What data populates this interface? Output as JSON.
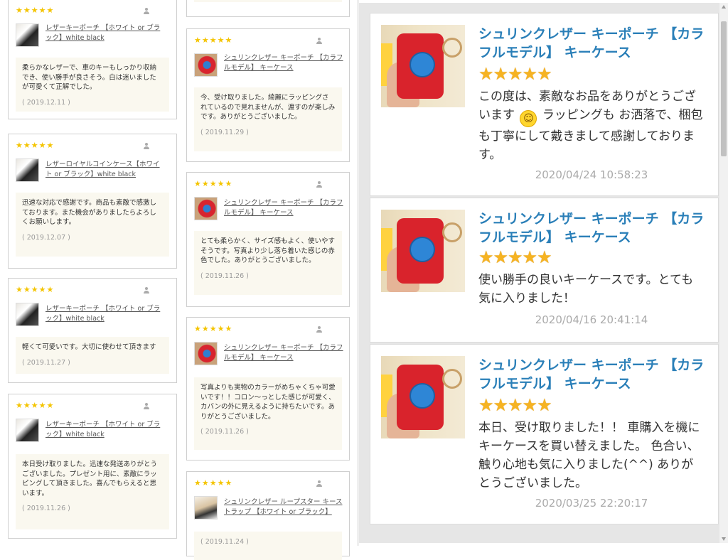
{
  "stars": "★★★★★",
  "left_column": [
    {
      "product": "レザーキーポーチ 【ホワイト or ブラック】white black",
      "body": "柔らかなレザーで、車のキーもしっかり収納でき、使い勝手が良さそう。白は迷いましたが可愛くて正解でした。",
      "date": "( 2019.12.11 )",
      "thumb": "white"
    },
    {
      "product": "レザーロイヤルコインケース【ホワイト or ブラック】white black",
      "body": "迅速な対応で感謝です。商品も素敵で感激しております。また機会がありましたらよろしくお願いします。",
      "date": "( 2019.12.07 )",
      "thumb": "white"
    },
    {
      "product": "レザーキーポーチ 【ホワイト or ブラック】white black",
      "body": "軽くて可愛いです。大切に使わせて頂きます",
      "date": "( 2019.11.27 )",
      "thumb": "white"
    },
    {
      "product": "レザーキーポーチ 【ホワイト or ブラック】white black",
      "body": "本日受け取りました。迅速な発送ありがとうございました。プレゼント用に、素敵にラッピングして頂きました。喜んでもらえると思います。",
      "date": "( 2019.11.26 )",
      "thumb": "white"
    }
  ],
  "middle_column": [
    {
      "product": "シュリンクレザー キーポーチ 【カラフルモデル】 キーケース",
      "body": "今、受け取りました。綺麗にラッピングされているので見れませんが、渡すのが楽しみです。ありがとうございました。",
      "date": "( 2019.11.29 )",
      "thumb": "red"
    },
    {
      "product": "シュリンクレザー キーポーチ 【カラフルモデル】 キーケース",
      "body": "とても柔らかく、サイズ感もよく、使いやすそうです。写真より少し落ち着いた感じの赤色でした。ありがとうございました。",
      "date": "( 2019.11.26 )",
      "thumb": "red"
    },
    {
      "product": "シュリンクレザー キーポーチ 【カラフルモデル】 キーケース",
      "body": "写真よりも実物のカラーがめちゃくちゃ可愛いです！！コロン〜っとした感じが可愛く、カバンの外に見えるように持ちたいです。ありがとうございました。",
      "date": "( 2019.11.26 )",
      "thumb": "red"
    },
    {
      "product": "シュリンクレザー ループスター キーストラップ 【ホワイト or ブラック】",
      "body": "",
      "date": "( 2019.11.24 )",
      "thumb": "rope"
    }
  ],
  "right_panel": [
    {
      "title": "シュリンクレザー キーポーチ 【カラフルモデル】 キーケース",
      "text_a": "この度は、素敵なお品をありがとうございます",
      "emoji": "☺",
      "text_b": "ラッピングも お洒落で、梱包も丁寧にして戴きまして感謝しております。",
      "date": "2020/04/24 10:58:23"
    },
    {
      "title": "シュリンクレザー キーポーチ 【カラフルモデル】 キーケース",
      "text_a": "使い勝手の良いキーケースです。とても気に入りました！",
      "emoji": "",
      "text_b": "",
      "date": "2020/04/16 20:41:14"
    },
    {
      "title": "シュリンクレザー キーポーチ 【カラフルモデル】 キーケース",
      "text_a": "本日、受け取りました！！ 車購入を機にキーケースを買い替えました。 色合い、触り心地も気に入りました(^^) ありがとうございました。",
      "emoji": "",
      "text_b": "",
      "date": "2020/03/25 22:20:17"
    }
  ]
}
